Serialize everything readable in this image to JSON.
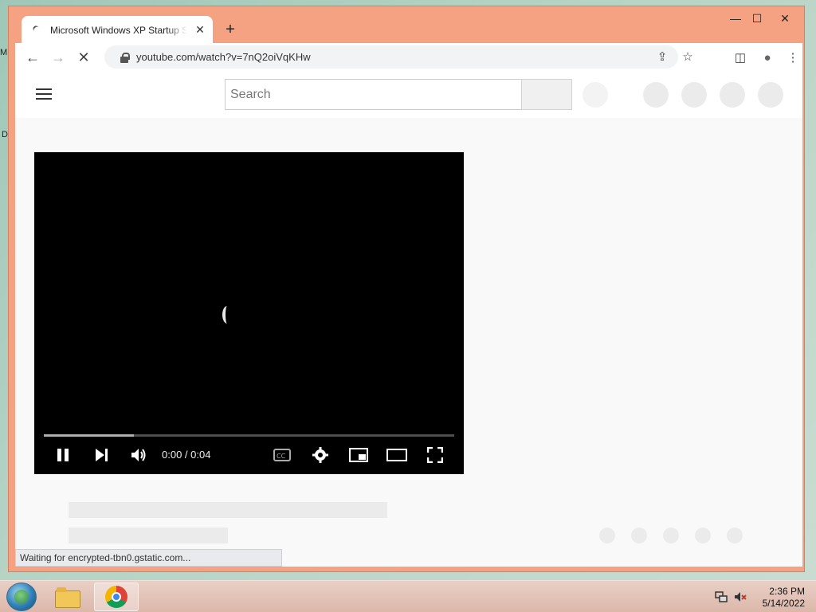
{
  "desktop": {
    "fragment_1": "M",
    "fragment_2": "D"
  },
  "browser": {
    "tab": {
      "title": "Microsoft Windows XP Startup S",
      "close_glyph": "✕"
    },
    "new_tab_glyph": "+",
    "window_controls": {
      "minimize": "—",
      "maximize": "☐",
      "close": "✕"
    },
    "toolbar": {
      "back": "←",
      "forward": "→",
      "reload": "✕",
      "url": "youtube.com/watch?v=7nQ2oiVqKHw",
      "share": "⇪",
      "bookmark": "☆",
      "side_panel": "◫",
      "profile": "●",
      "menu": "⋮"
    },
    "status_text": "Waiting for encrypted-tbn0.gstatic.com..."
  },
  "youtube": {
    "search": {
      "placeholder": "Search"
    },
    "player": {
      "time": "0:00 / 0:04",
      "progress_fraction": 0.0,
      "buffered_fraction": 0.22
    }
  },
  "taskbar": {
    "clock_time": "2:36 PM",
    "clock_date": "5/14/2022"
  },
  "icons": {
    "start": "start-orb-icon",
    "explorer": "folder-icon",
    "chrome": "chrome-icon",
    "network": "network-icon",
    "volume": "volume-muted-icon"
  },
  "colors": {
    "window_frame": "#f5a283",
    "player_bg": "#000000",
    "taskbar": "#dcb8aa"
  }
}
